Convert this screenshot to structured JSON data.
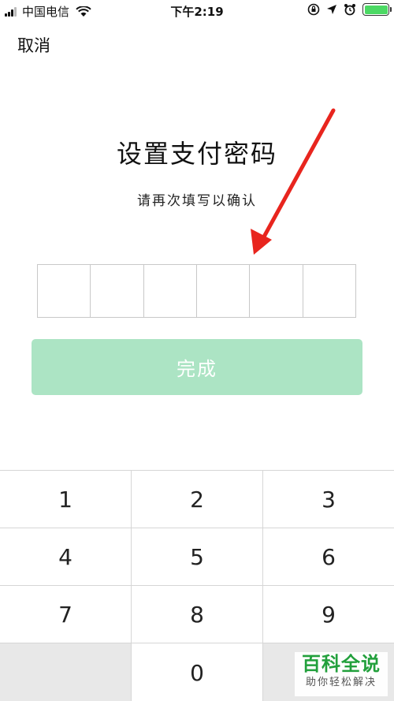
{
  "status_bar": {
    "carrier": "中国电信",
    "time": "下午2:19",
    "icons": [
      "signal-icon",
      "wifi-icon",
      "rotation-lock-icon",
      "location-icon",
      "alarm-icon",
      "battery-icon"
    ],
    "battery_level": 1.0,
    "battery_color": "#4cd964"
  },
  "header": {
    "cancel_label": "取消"
  },
  "main": {
    "title": "设置支付密码",
    "subtitle": "请再次填写以确认",
    "pin_digits": [
      "",
      "",
      "",
      "",
      "",
      ""
    ],
    "done_label": "完成",
    "done_color": "#ace4c4"
  },
  "annotation": {
    "arrow_color": "#e8251e"
  },
  "keypad": {
    "rows": [
      [
        "1",
        "2",
        "3"
      ],
      [
        "4",
        "5",
        "6"
      ],
      [
        "7",
        "8",
        "9"
      ],
      [
        "",
        "0",
        ""
      ]
    ]
  },
  "watermark": {
    "main": "百科全说",
    "sub": "助你轻松解决"
  }
}
